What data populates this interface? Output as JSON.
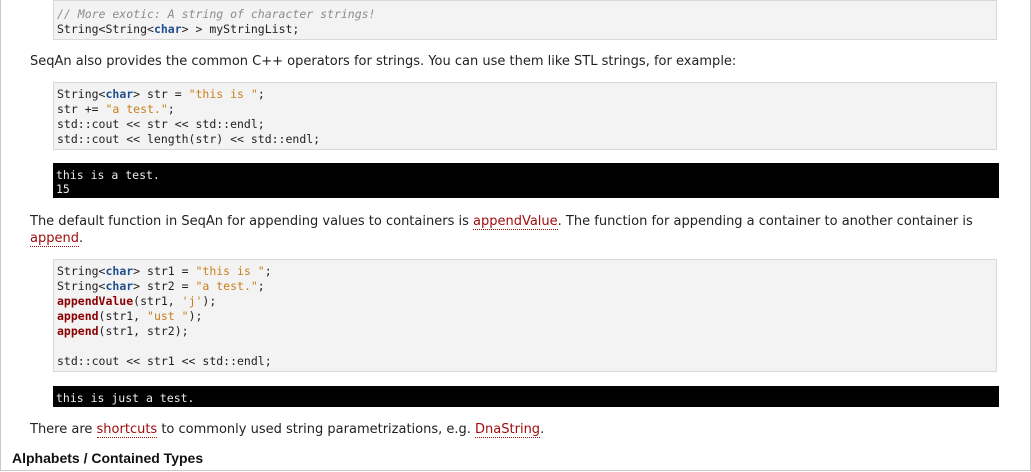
{
  "block1": {
    "comment": "// More exotic: A string of character strings!",
    "line2": {
      "a": "String<String<",
      "kw": "char",
      "b": "> > myStringList;"
    }
  },
  "para1": "SeqAn also provides the common C++ operators for strings. You can use them like STL strings, for example:",
  "block2": {
    "l1": {
      "a": "String<",
      "kw": "char",
      "b": "> str = ",
      "s": "\"this is \"",
      "c": ";"
    },
    "l2": {
      "a": "str += ",
      "s": "\"a test.\"",
      "c": ";"
    },
    "l3": "std::cout << str << std::endl;",
    "l4": "std::cout << length(str) << std::endl;"
  },
  "output1": {
    "l1": "this is a test.",
    "l2": "15"
  },
  "para2": {
    "t1": "The default function in SeqAn for appending values to containers is ",
    "link1": "appendValue",
    "t2": ". The function for appending a container to another container is ",
    "link2": "append",
    "t3": "."
  },
  "block3": {
    "l1": {
      "a": "String<",
      "kw": "char",
      "b": "> str1 = ",
      "s": "\"this is \"",
      "c": ";"
    },
    "l2": {
      "a": "String<",
      "kw": "char",
      "b": "> str2 = ",
      "s": "\"a test.\"",
      "c": ";"
    },
    "l3": {
      "fn": "appendValue",
      "a": "(str1, ",
      "s": "'j'",
      "c": ");"
    },
    "l4": {
      "fn": "append",
      "a": "(str1, ",
      "s": "\"ust \"",
      "c": ");"
    },
    "l5": {
      "fn": "append",
      "a": "(str1, str2);"
    },
    "l7": "std::cout << str1 << std::endl;"
  },
  "output2": {
    "l1": "this is just a test."
  },
  "para3": {
    "t1": "There are ",
    "link1": "shortcuts",
    "t2": " to commonly used string parametrizations, e.g. ",
    "link2": "DnaString",
    "t3": "."
  },
  "heading": "Alphabets / Contained Types"
}
